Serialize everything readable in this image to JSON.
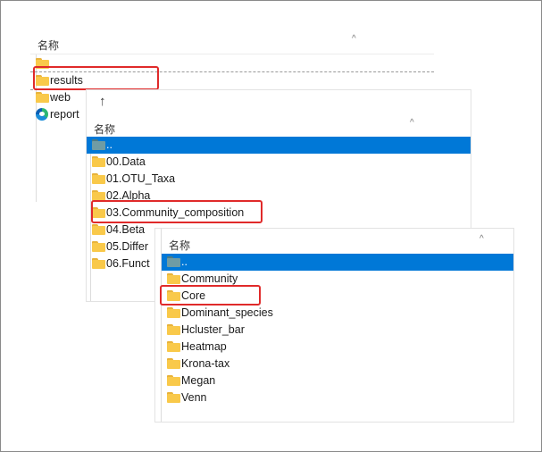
{
  "panel1": {
    "header": "名称",
    "items": [
      {
        "label": "",
        "icon": "folder-icon"
      },
      {
        "label": "results",
        "icon": "folder-icon"
      },
      {
        "label": "web",
        "icon": "folder-icon"
      },
      {
        "label": "report",
        "icon": "edge-browser-icon"
      }
    ]
  },
  "panel2": {
    "up_arrow": "↑",
    "header": "名称",
    "items": [
      {
        "label": "..",
        "icon": "folder-up-icon",
        "selected": true
      },
      {
        "label": "00.Data",
        "icon": "folder-icon"
      },
      {
        "label": "01.OTU_Taxa",
        "icon": "folder-icon"
      },
      {
        "label": "02.Alpha",
        "icon": "folder-icon"
      },
      {
        "label": "03.Community_composition",
        "icon": "folder-icon"
      },
      {
        "label": "04.Beta",
        "icon": "folder-icon"
      },
      {
        "label": "05.Differ",
        "icon": "folder-icon"
      },
      {
        "label": "06.Funct",
        "icon": "folder-icon"
      }
    ]
  },
  "panel3": {
    "header": "名称",
    "items": [
      {
        "label": "..",
        "icon": "folder-up-icon",
        "selected": true
      },
      {
        "label": "Community",
        "icon": "folder-icon"
      },
      {
        "label": "Core",
        "icon": "folder-icon"
      },
      {
        "label": "Dominant_species",
        "icon": "folder-icon"
      },
      {
        "label": "Hcluster_bar",
        "icon": "folder-icon"
      },
      {
        "label": "Heatmap",
        "icon": "folder-icon"
      },
      {
        "label": "Krona-tax",
        "icon": "folder-icon"
      },
      {
        "label": "Megan",
        "icon": "folder-icon"
      },
      {
        "label": "Venn",
        "icon": "folder-icon"
      }
    ]
  },
  "colors": {
    "selection": "#0078d7",
    "highlight": "#e02a2a",
    "folder": "#f9c94a"
  }
}
